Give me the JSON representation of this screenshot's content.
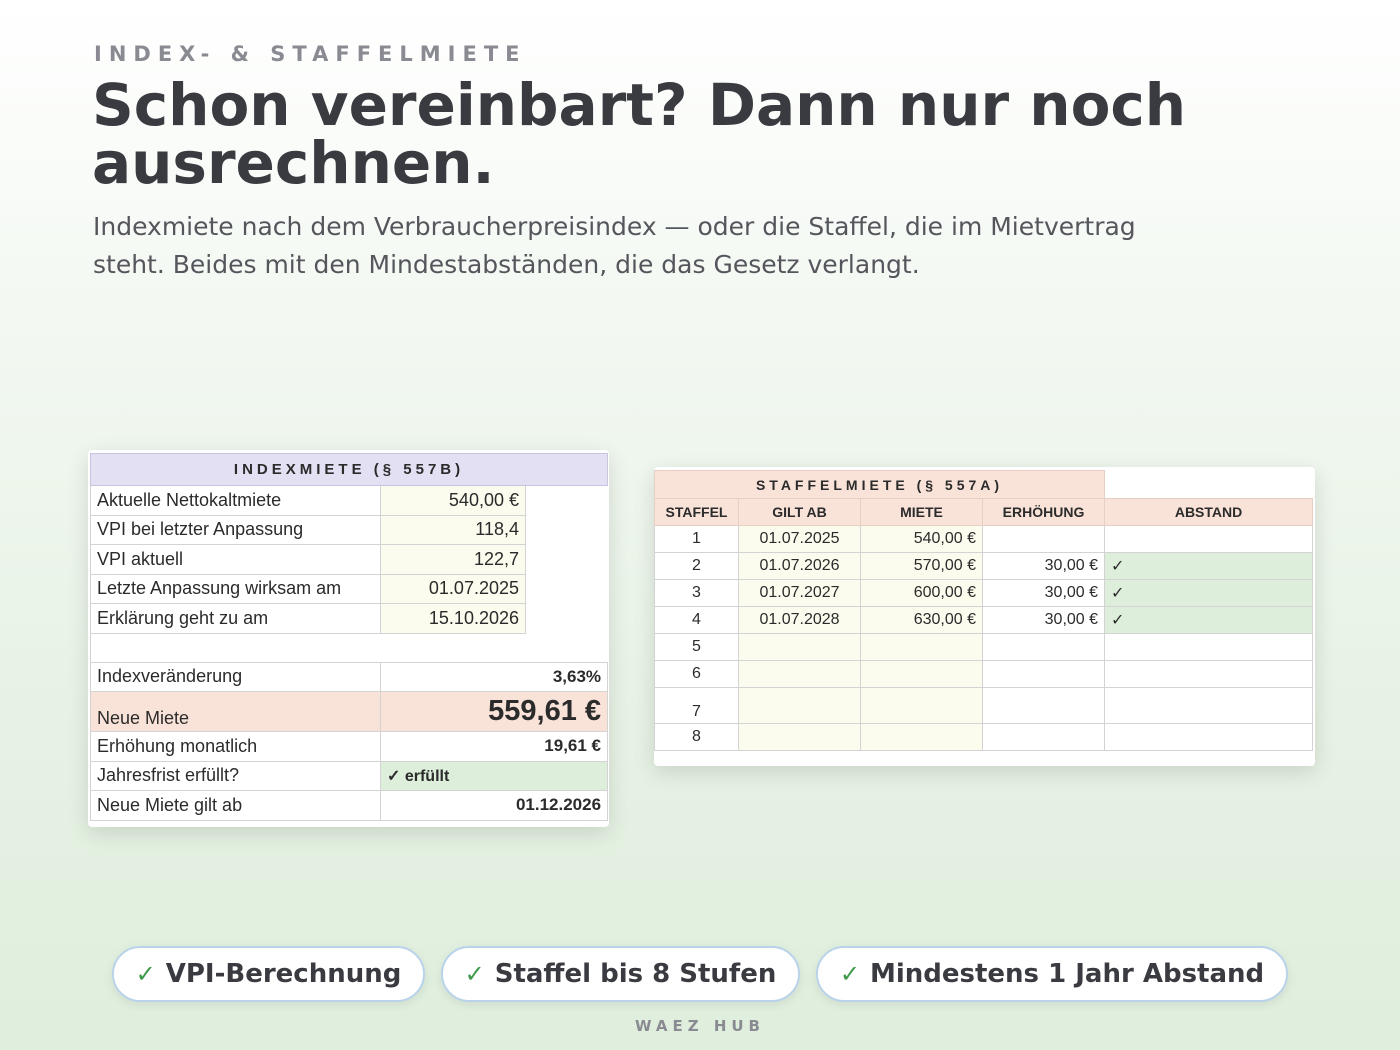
{
  "hero": {
    "eyebrow": "INDEX- & STAFFELMIETE",
    "headline": "Schon vereinbart? Dann nur noch ausrechnen.",
    "subline": "Indexmiete nach dem Verbraucherpreisindex — oder die Staffel, die im Mietvertrag steht. Beides mit den Mindestabständen, die das Gesetz verlangt."
  },
  "index_sheet": {
    "title": "INDEXMIETE (§ 557B)",
    "inputs": [
      {
        "label": "Aktuelle Nettokaltmiete",
        "value": "540,00 €"
      },
      {
        "label": "VPI bei letzter Anpassung",
        "value": "118,4"
      },
      {
        "label": "VPI aktuell",
        "value": "122,7"
      },
      {
        "label": "Letzte Anpassung wirksam am",
        "value": "01.07.2025"
      },
      {
        "label": "Erklärung geht zu am",
        "value": "15.10.2026"
      }
    ],
    "results": {
      "index_change": {
        "label": "Indexveränderung",
        "value": "3,63%"
      },
      "new_rent": {
        "label": "Neue Miete",
        "value": "559,61 €"
      },
      "monthly_increase": {
        "label": "Erhöhung monatlich",
        "value": "19,61 €"
      },
      "annual_check": {
        "label": "Jahresfrist erfüllt?",
        "value": "✓ erfüllt"
      },
      "effective_from": {
        "label": "Neue Miete gilt ab",
        "value": "01.12.2026"
      }
    }
  },
  "staffel_sheet": {
    "title": "STAFFELMIETE (§ 557A)",
    "columns": [
      "STAFFEL",
      "GILT AB",
      "MIETE",
      "ERHÖHUNG",
      "ABSTAND"
    ],
    "rows": [
      {
        "n": "1",
        "date": "01.07.2025",
        "rent": "540,00 €",
        "increase": "",
        "gap": ""
      },
      {
        "n": "2",
        "date": "01.07.2026",
        "rent": "570,00 €",
        "increase": "30,00 €",
        "gap": "✓"
      },
      {
        "n": "3",
        "date": "01.07.2027",
        "rent": "600,00 €",
        "increase": "30,00 €",
        "gap": "✓"
      },
      {
        "n": "4",
        "date": "01.07.2028",
        "rent": "630,00 €",
        "increase": "30,00 €",
        "gap": "✓"
      },
      {
        "n": "5",
        "date": "",
        "rent": "",
        "increase": "",
        "gap": ""
      },
      {
        "n": "6",
        "date": "",
        "rent": "",
        "increase": "",
        "gap": ""
      },
      {
        "n": "7",
        "date": "",
        "rent": "",
        "increase": "",
        "gap": ""
      },
      {
        "n": "8",
        "date": "",
        "rent": "",
        "increase": "",
        "gap": ""
      }
    ]
  },
  "features": [
    {
      "icon": "check-icon",
      "tick": "✓",
      "label": "VPI-Berechnung"
    },
    {
      "icon": "check-icon",
      "tick": "✓",
      "label": "Staffel bis 8 Stufen"
    },
    {
      "icon": "check-icon",
      "tick": "✓",
      "label": "Mindestens 1 Jahr Abstand"
    }
  ],
  "footer": {
    "brand": "WAEZ HUB"
  },
  "colors": {
    "index_header": "#e4e0f3",
    "staffel_header": "#f9e3d8",
    "input_cell": "#fbfbee",
    "ok_cell": "#ddeedb",
    "pill_border": "#b9d3ea",
    "tick_green": "#3d9a4a"
  }
}
